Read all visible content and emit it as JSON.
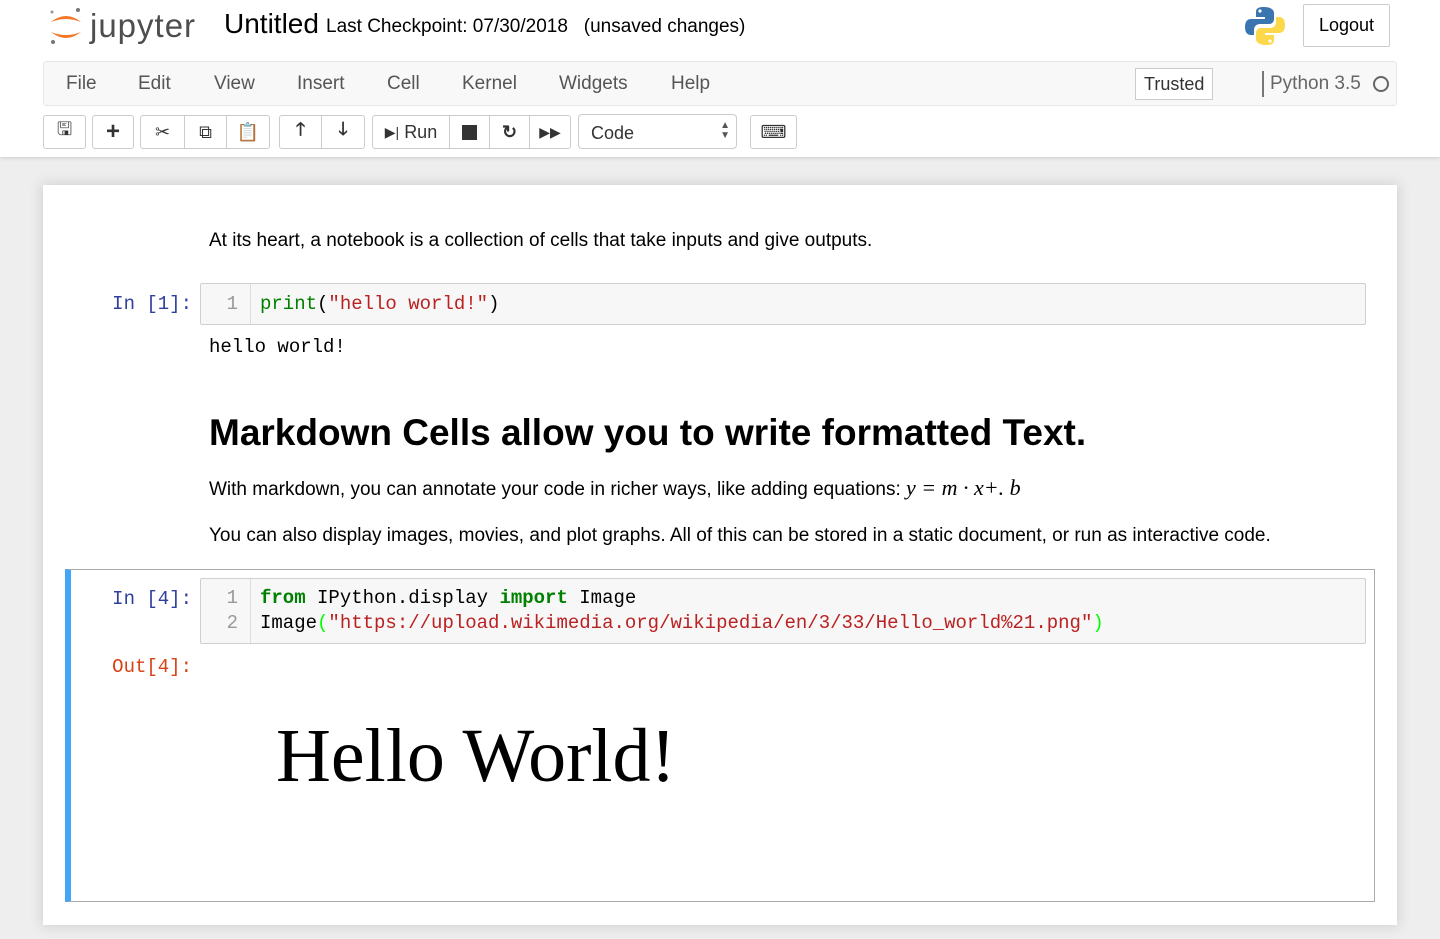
{
  "header": {
    "logo_text": "jupyter",
    "title": "Untitled",
    "checkpoint": "Last Checkpoint: 07/30/2018",
    "status": "(unsaved changes)",
    "logout": "Logout"
  },
  "menu": {
    "items": [
      "File",
      "Edit",
      "View",
      "Insert",
      "Cell",
      "Kernel",
      "Widgets",
      "Help"
    ],
    "trusted": "Trusted",
    "kernel": "Python 3.5"
  },
  "toolbar": {
    "run": "Run",
    "cell_type": "Code",
    "icons": [
      "save-icon",
      "plus-icon",
      "cut-icon",
      "copy-icon",
      "paste-icon",
      "arrow-up-icon",
      "arrow-down-icon",
      "step-forward-icon",
      "stop-icon",
      "restart-icon",
      "fast-forward-icon",
      "keyboard-icon"
    ]
  },
  "cells": {
    "intro": "At its heart, a notebook is a collection of cells that take inputs and give outputs.",
    "c1": {
      "prompt": "In [1]:",
      "ln": "1",
      "fn": "print",
      "p1": "(",
      "str": "\"hello world!\"",
      "p2": ")",
      "output": "hello world!"
    },
    "md": {
      "heading": "Markdown Cells allow you to write formatted Text.",
      "p1": "With markdown, you can annotate your code in richer ways, like adding equations:",
      "eq": "y = m · x+. b",
      "p2": "You can also display images, movies, and plot graphs. All of this can be stored in a static document, or run as interactive code."
    },
    "c2": {
      "prompt": "In [4]:",
      "ln1": "1",
      "ln2": "2",
      "from": "from",
      "mod": " IPython.display ",
      "imp": "import",
      "name": " Image",
      "call": "Image",
      "po": "(",
      "url": "\"https://upload.wikimedia.org/wikipedia/en/3/33/Hello_world%21.png\"",
      "pc": ")",
      "out_prompt": "Out[4]:",
      "image_text": "Hello World!"
    }
  },
  "colors": {
    "accent": "#42a5f5",
    "prompt_in": "#303f9f",
    "prompt_out": "#d84315",
    "keyword": "#008000",
    "string": "#ba2121"
  }
}
